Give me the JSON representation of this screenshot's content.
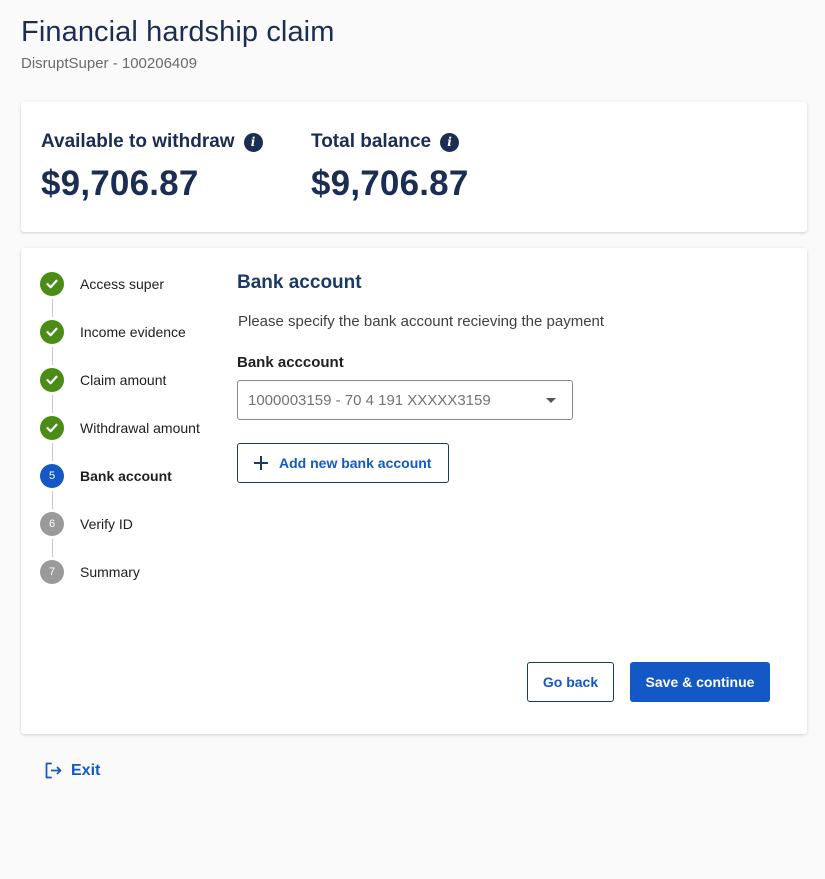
{
  "header": {
    "title": "Financial hardship claim",
    "subtitle": "DisruptSuper - 100206409"
  },
  "balances": {
    "available_label": "Available to withdraw",
    "available_amount": "$9,706.87",
    "total_label": "Total balance",
    "total_amount": "$9,706.87",
    "info_glyph": "i"
  },
  "stepper": {
    "steps": [
      {
        "number": "1",
        "label": "Access super",
        "status": "done"
      },
      {
        "number": "2",
        "label": "Income evidence",
        "status": "done"
      },
      {
        "number": "3",
        "label": "Claim amount",
        "status": "done"
      },
      {
        "number": "4",
        "label": "Withdrawal amount",
        "status": "done"
      },
      {
        "number": "5",
        "label": "Bank account",
        "status": "active"
      },
      {
        "number": "6",
        "label": "Verify ID",
        "status": "pending"
      },
      {
        "number": "7",
        "label": "Summary",
        "status": "pending"
      }
    ]
  },
  "form": {
    "section_title": "Bank account",
    "description": "Please specify the bank account recieving the payment",
    "field_label": "Bank acccount",
    "selected_account": "1000003159 - 70 4 191 XXXXX3159",
    "add_button_label": "Add new bank account"
  },
  "actions": {
    "back_label": "Go back",
    "continue_label": "Save & continue"
  },
  "footer": {
    "exit_label": "Exit"
  },
  "colors": {
    "navy": "#1b2d52",
    "primary": "#1358c4",
    "success": "#4a8c16",
    "pending": "#9a9a9a"
  }
}
